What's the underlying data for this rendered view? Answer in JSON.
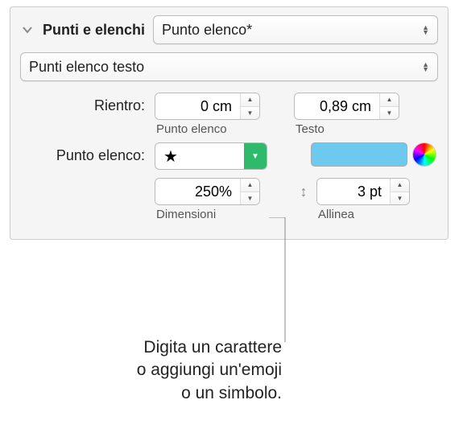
{
  "header": {
    "title": "Punti e elenchi",
    "style_popup": "Punto elenco*"
  },
  "type_popup": "Punti elenco testo",
  "indent": {
    "label": "Rientro:",
    "bullet_value": "0 cm",
    "bullet_sublabel": "Punto elenco",
    "text_value": "0,89 cm",
    "text_sublabel": "Testo"
  },
  "bullet": {
    "label": "Punto elenco:",
    "char": "★"
  },
  "size": {
    "value": "250%",
    "sublabel": "Dimensioni"
  },
  "align": {
    "value": "3 pt",
    "sublabel": "Allinea"
  },
  "callout": {
    "line1": "Digita un carattere",
    "line2": "o aggiungi un'emoji",
    "line3": "o un simbolo."
  }
}
